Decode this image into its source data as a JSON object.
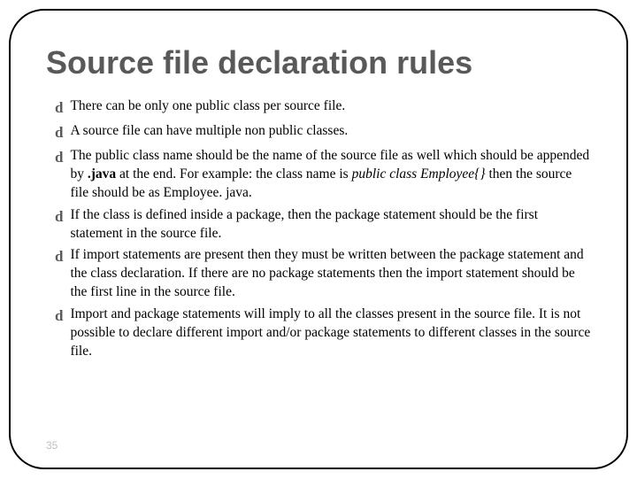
{
  "title": "Source file declaration rules",
  "bullets": [
    {
      "segments": [
        {
          "t": "There can be only one public class per source file."
        }
      ]
    },
    {
      "segments": [
        {
          "t": "A source file can have multiple non public classes."
        }
      ]
    },
    {
      "segments": [
        {
          "t": "The public class name should be the name of the source file as well which should be appended by "
        },
        {
          "t": ".java",
          "b": true
        },
        {
          "t": " at the end. For example: the class name is "
        },
        {
          "t": "public class Employee{}",
          "i": true
        },
        {
          "t": " then the source file should be as Employee. java."
        }
      ]
    },
    {
      "segments": [
        {
          "t": "If the class is defined inside a package, then the package statement should be the first statement in the source file."
        }
      ]
    },
    {
      "segments": [
        {
          "t": "If import statements are present then they must be written between the package statement and the class declaration. If there are no package statements then the import statement should be the first line in the source file."
        }
      ]
    },
    {
      "segments": [
        {
          "t": "Import and package statements will imply to all the classes present in the source file. It is not possible to declare different import and/or package statements to different classes in the source file."
        }
      ]
    }
  ],
  "bullet_glyph": "d",
  "page_number": "35"
}
